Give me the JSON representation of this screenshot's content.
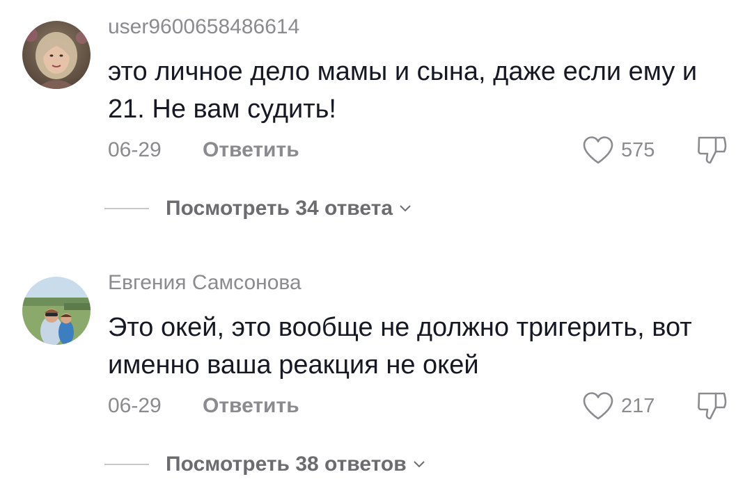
{
  "comments": [
    {
      "username": "user9600658486614",
      "text": "это личное дело мамы и сына, даже если ему и 21. Не вам судить!",
      "date": "06-29",
      "reply_label": "Ответить",
      "likes": "575",
      "view_replies_label": "Посмотреть 34 ответа"
    },
    {
      "username": "Евгения Самсонова",
      "text": "Это окей, это вообще не должно тригерить, вот именно ваша реакция не окей",
      "date": "06-29",
      "reply_label": "Ответить",
      "likes": "217",
      "view_replies_label": "Посмотреть 38 ответов"
    }
  ],
  "icons": {
    "like": "heart-outline-icon",
    "dislike": "thumbs-down-icon",
    "expand": "chevron-down-icon"
  },
  "colors": {
    "primary_text": "#161823",
    "secondary_text": "#8a8a8f",
    "divider": "#c8c8cc"
  }
}
